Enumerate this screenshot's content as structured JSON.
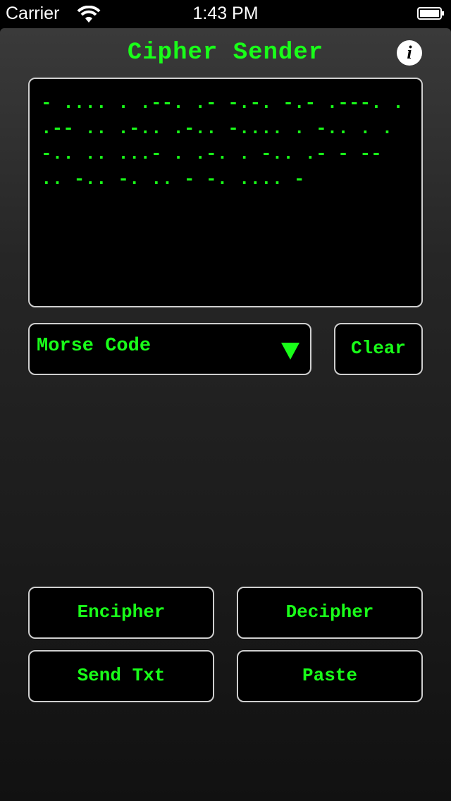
{
  "status_bar": {
    "carrier": "Carrier",
    "time": "1:43 PM"
  },
  "app": {
    "title": "Cipher Sender",
    "info_label": "i",
    "message_text": "- .... .  .--. .- -.-. -.- .---. .  .-- .. .-.. .-..  -.... . -.. . .-.. .. ...- . .-. . -..  .- -  -- .. -.. -. .. - -. .... -",
    "cipher_select": {
      "selected": "Morse Code"
    },
    "buttons": {
      "clear": "Clear",
      "encipher": "Encipher",
      "decipher": "Decipher",
      "send_txt": "Send Txt",
      "paste": "Paste"
    }
  },
  "colors": {
    "accent_green": "#19ff19",
    "border": "#cfcfcf",
    "background": "#000000"
  }
}
